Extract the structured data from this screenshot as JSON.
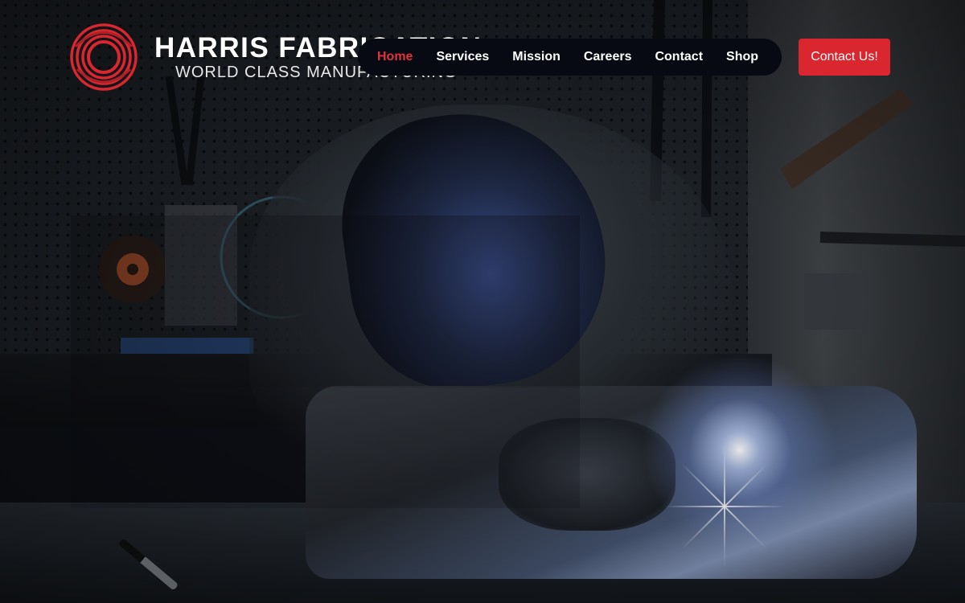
{
  "brand": {
    "name": "HARRIS FABRICATION",
    "tagline": "WORLD CLASS MANUFACTURING",
    "logo_icon": "concentric-rings-logo",
    "accent_color": "#d9262f"
  },
  "nav": {
    "items": [
      {
        "label": "Home",
        "active": true
      },
      {
        "label": "Services",
        "active": false
      },
      {
        "label": "Mission",
        "active": false
      },
      {
        "label": "Careers",
        "active": false
      },
      {
        "label": "Contact",
        "active": false
      },
      {
        "label": "Shop",
        "active": false
      }
    ],
    "background": "#070a12",
    "active_color": "#e0323c"
  },
  "cta": {
    "label": "Contact Us!"
  },
  "hero": {
    "image_subject": "welder-at-work-photo"
  }
}
